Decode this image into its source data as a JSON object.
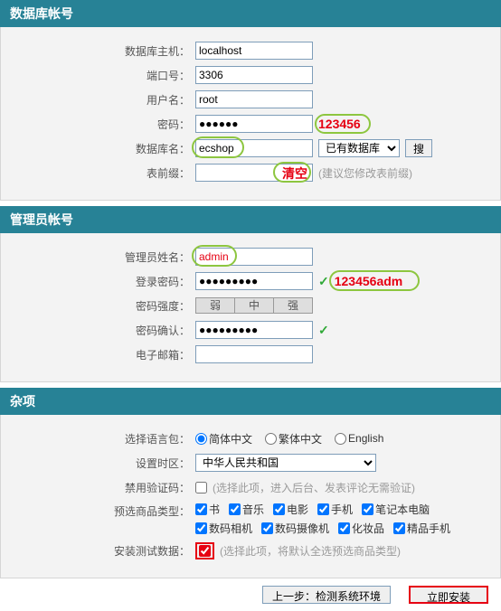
{
  "sections": {
    "db": {
      "title": "数据库帐号"
    },
    "admin": {
      "title": "管理员帐号"
    },
    "misc": {
      "title": "杂项"
    }
  },
  "db": {
    "host_label": "数据库主机：",
    "host_value": "localhost",
    "port_label": "端口号：",
    "port_value": "3306",
    "user_label": "用户名：",
    "user_value": "root",
    "pass_label": "密码：",
    "pass_value": "●●●●●●",
    "pass_annot": "123456",
    "dbname_label": "数据库名：",
    "dbname_value": "ecshop",
    "dbselect_value": "已有数据库",
    "search_btn": "搜",
    "prefix_label": "表前缀：",
    "prefix_value": "",
    "prefix_annot": "清空",
    "prefix_hint": "(建议您修改表前缀)"
  },
  "admin": {
    "name_label": "管理员姓名：",
    "name_value": "admin",
    "pass_label": "登录密码：",
    "pass_value": "●●●●●●●●●",
    "pass_annot": "123456adm",
    "strength_label": "密码强度：",
    "strength_weak": "弱",
    "strength_mid": "中",
    "strength_strong": "强",
    "confirm_label": "密码确认：",
    "confirm_value": "●●●●●●●●●",
    "email_label": "电子邮箱：",
    "email_value": ""
  },
  "misc": {
    "lang_label": "选择语言包：",
    "lang_cn": "简体中文",
    "lang_tw": "繁体中文",
    "lang_en": "English",
    "tz_label": "设置时区：",
    "tz_value": "中华人民共和国",
    "captcha_label": "禁用验证码：",
    "captcha_hint": "(选择此项，进入后台、发表评论无需验证)",
    "goods_label": "预选商品类型：",
    "cat_book": "书",
    "cat_music": "音乐",
    "cat_movie": "电影",
    "cat_mobile": "手机",
    "cat_laptop": "笔记本电脑",
    "cat_camera": "数码相机",
    "cat_dv": "数码摄像机",
    "cat_cosmetic": "化妆品",
    "cat_luxmobile": "精品手机",
    "testdata_label": "安装测试数据：",
    "testdata_hint": "(选择此项，将默认全选预选商品类型)"
  },
  "footer": {
    "back_btn": "上一步：检测系统环境",
    "install_btn": "立即安装"
  }
}
